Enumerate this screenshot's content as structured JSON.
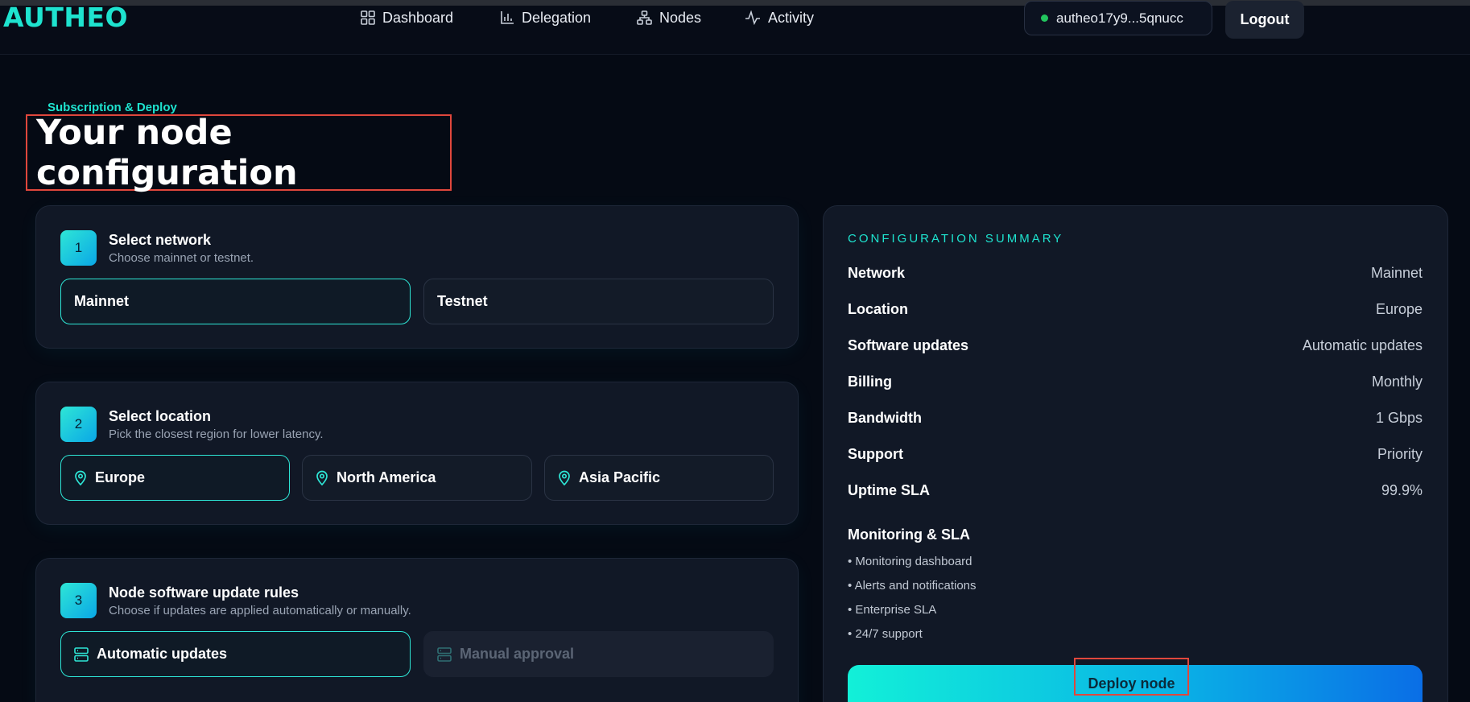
{
  "header": {
    "logo": "AUTHEO",
    "nav": [
      {
        "label": "Dashboard",
        "icon": "grid-icon"
      },
      {
        "label": "Delegation",
        "icon": "bar-chart-icon"
      },
      {
        "label": "Nodes",
        "icon": "network-icon"
      },
      {
        "label": "Activity",
        "icon": "activity-icon"
      }
    ],
    "wallet": {
      "address": "autheo17y9...5qnucc",
      "status_color": "#22c55e"
    },
    "logout_label": "Logout"
  },
  "page": {
    "eyebrow": "Subscription & Deploy",
    "title": "Your node configuration"
  },
  "steps": [
    {
      "number": "1",
      "title": "Select network",
      "subtitle": "Choose mainnet or testnet.",
      "options": [
        {
          "label": "Mainnet",
          "selected": true
        },
        {
          "label": "Testnet",
          "selected": false
        }
      ]
    },
    {
      "number": "2",
      "title": "Select location",
      "subtitle": "Pick the closest region for lower latency.",
      "options": [
        {
          "label": "Europe",
          "selected": true,
          "icon": "map-pin-icon"
        },
        {
          "label": "North America",
          "selected": false,
          "icon": "map-pin-icon"
        },
        {
          "label": "Asia Pacific",
          "selected": false,
          "icon": "map-pin-icon"
        }
      ]
    },
    {
      "number": "3",
      "title": "Node software update rules",
      "subtitle": "Choose if updates are applied automatically or manually.",
      "options": [
        {
          "label": "Automatic updates",
          "selected": true,
          "icon": "server-icon"
        },
        {
          "label": "Manual approval",
          "selected": false,
          "disabled": true,
          "icon": "server-icon"
        }
      ]
    }
  ],
  "summary": {
    "heading": "CONFIGURATION SUMMARY",
    "rows": [
      {
        "key": "Network",
        "value": "Mainnet"
      },
      {
        "key": "Location",
        "value": "Europe"
      },
      {
        "key": "Software updates",
        "value": "Automatic updates"
      },
      {
        "key": "Billing",
        "value": "Monthly"
      },
      {
        "key": "Bandwidth",
        "value": "1 Gbps"
      },
      {
        "key": "Support",
        "value": "Priority"
      },
      {
        "key": "Uptime SLA",
        "value": "99.9%"
      }
    ],
    "monitoring_title": "Monitoring & SLA",
    "monitoring_items": [
      "• Monitoring dashboard",
      "• Alerts and notifications",
      "• Enterprise SLA",
      "• 24/7 support"
    ],
    "deploy_label": "Deploy node"
  },
  "colors": {
    "accent": "#1ee3cf",
    "background": "#050a14",
    "card": "#111826",
    "highlight_outline": "#e0473c"
  }
}
